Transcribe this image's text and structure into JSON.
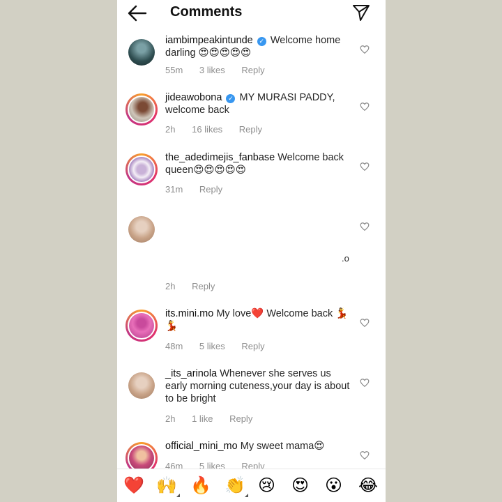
{
  "header": {
    "title": "Comments",
    "back_icon": "arrow-left-icon",
    "send_icon": "paper-plane-icon"
  },
  "comments": [
    {
      "username": "iambimpeakintunde",
      "verified": true,
      "text": "Welcome home darling 😍😍😍😍😍",
      "time": "55m",
      "likes": "3 likes",
      "reply": "Reply"
    },
    {
      "username": "jideawobona",
      "verified": true,
      "text": "MY MURASI PADDY, welcome back",
      "time": "2h",
      "likes": "16 likes",
      "reply": "Reply"
    },
    {
      "username": "the_adedimejis_fanbase",
      "verified": false,
      "text": "Welcome back queen😍😍😍😍😍",
      "time": "31m",
      "likes": "",
      "reply": "Reply"
    },
    {
      "username": "",
      "verified": false,
      "text": ".o",
      "time": "2h",
      "likes": "",
      "reply": "Reply"
    },
    {
      "username": "its.mini.mo",
      "verified": false,
      "text": "My love❤️ Welcome back 💃💃",
      "time": "48m",
      "likes": "5 likes",
      "reply": "Reply"
    },
    {
      "username": "_its_arinola",
      "verified": false,
      "text": "Whenever she serves us early morning cuteness,your day is about to be bright",
      "time": "2h",
      "likes": "1 like",
      "reply": "Reply"
    },
    {
      "username": "official_mini_mo",
      "verified": false,
      "text": "My sweet mama😍",
      "time": "46m",
      "likes": "5 likes",
      "reply": "Reply"
    }
  ],
  "emoji_bar": [
    "❤️",
    "🙌",
    "🔥",
    "👏",
    "😢",
    "😍",
    "😮",
    "😂"
  ],
  "colors": {
    "verified": "#3897f0",
    "meta": "#8e8e8e",
    "background": "#d2d0c4"
  }
}
